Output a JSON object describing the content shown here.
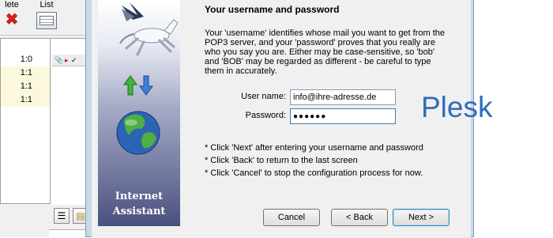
{
  "background_app": {
    "toolbar": {
      "delete_label": "lete",
      "list_label": "List"
    },
    "message_ratios": [
      "1:0",
      "1:1",
      "1:1",
      "1:1"
    ]
  },
  "wizard": {
    "art_caption_line1": "Internet",
    "art_caption_line2": "Assistant",
    "title": "Your username and password",
    "description": "Your 'username' identifies whose mail you want to get from the POP3 server, and your 'password' proves that you really are who you say you are. Either may be case-sensitive, so 'bob' and 'BOB' may be regarded as different - be careful to type them in accurately.",
    "username_label": "User name:",
    "username_value": "info@ihre-adresse.de",
    "password_label": "Password:",
    "password_value": "●●●●●●",
    "hints": [
      "* Click 'Next' after entering your username and password",
      "* Click 'Back' to return to the last screen",
      "* Click 'Cancel' to stop the configuration process for now."
    ],
    "cancel_label": "Cancel",
    "back_label": "< Back",
    "next_label": "Next >"
  },
  "watermark": {
    "text": "Plesk"
  },
  "colors": {
    "accent": "#2f6db8",
    "art_panel_dark": "#4a507e",
    "highlight_row": "#fbf8de"
  }
}
